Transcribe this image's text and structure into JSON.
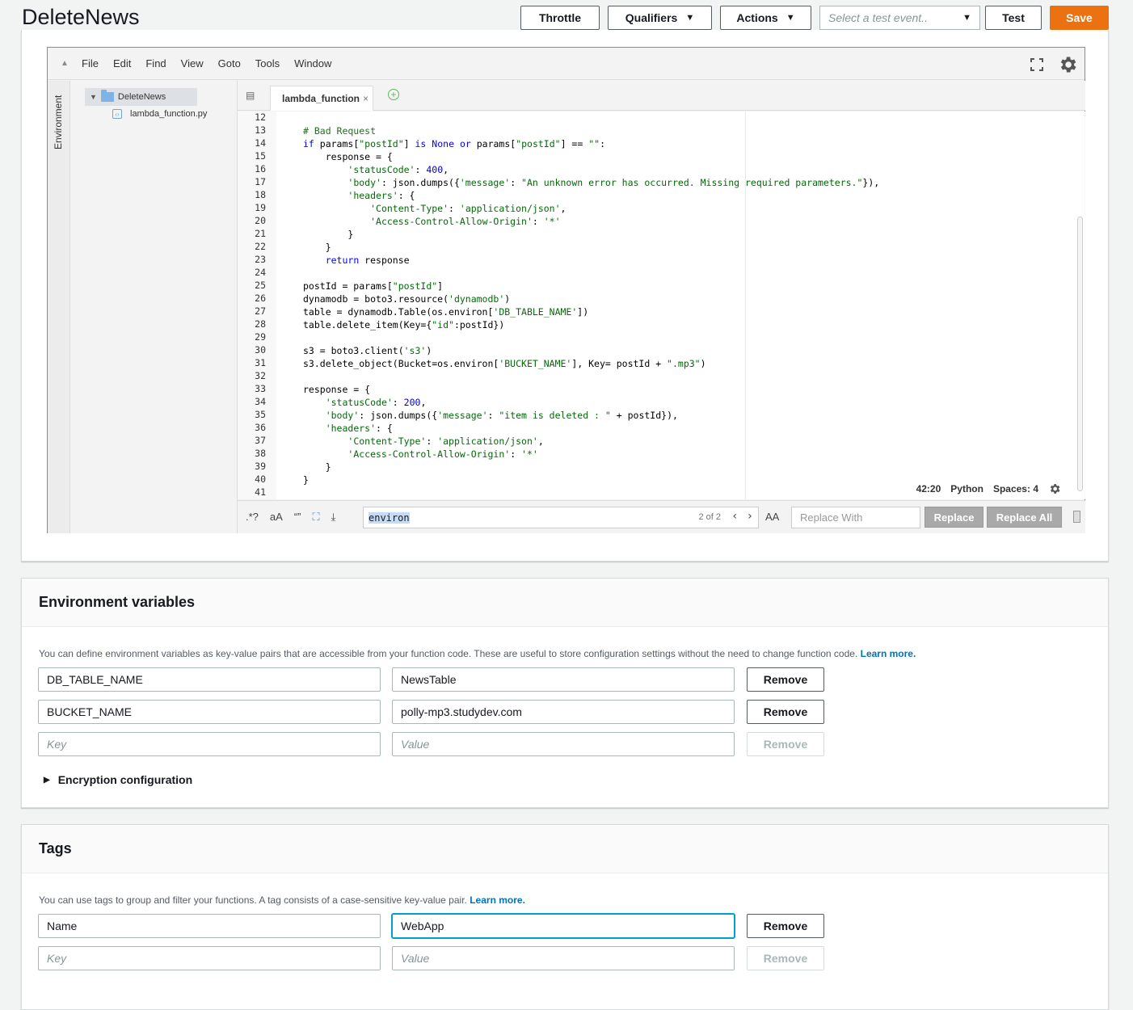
{
  "header": {
    "title": "DeleteNews",
    "throttle": "Throttle",
    "qualifiers": "Qualifiers",
    "actions": "Actions",
    "test_event_placeholder": "Select a test event..",
    "test": "Test",
    "save": "Save"
  },
  "ide": {
    "menu": [
      "File",
      "Edit",
      "Find",
      "View",
      "Goto",
      "Tools",
      "Window"
    ],
    "side_tab": "Environment",
    "tree": {
      "root": "DeleteNews",
      "file": "lambda_function.py"
    },
    "tab": "lambda_function",
    "line_numbers": [
      "12",
      "13",
      "14",
      "15",
      "16",
      "17",
      "18",
      "19",
      "20",
      "21",
      "22",
      "23",
      "24",
      "25",
      "26",
      "27",
      "28",
      "29",
      "30",
      "31",
      "32",
      "33",
      "34",
      "35",
      "36",
      "37",
      "38",
      "39",
      "40",
      "41"
    ],
    "status": {
      "cursor": "42:20",
      "language": "Python",
      "spaces": "Spaces: 4"
    },
    "find": {
      "query": "environ",
      "count": "2 of 2",
      "replace_placeholder": "Replace With",
      "replace": "Replace",
      "replace_all": "Replace All",
      "opt_regex": ".*?",
      "opt_case": "aA",
      "opt_word": "“”",
      "opt_selection": "⛶",
      "opt_aa": "AA"
    }
  },
  "env": {
    "title": "Environment variables",
    "description": "You can define environment variables as key-value pairs that are accessible from your function code. These are useful to store configuration settings without the need to change function code.",
    "learn_more": "Learn more.",
    "rows": [
      {
        "key": "DB_TABLE_NAME",
        "value": "NewsTable"
      },
      {
        "key": "BUCKET_NAME",
        "value": "polly-mp3.studydev.com"
      }
    ],
    "key_placeholder": "Key",
    "value_placeholder": "Value",
    "remove": "Remove",
    "encryption": "Encryption configuration"
  },
  "tags": {
    "title": "Tags",
    "description": "You can use tags to group and filter your functions. A tag consists of a case-sensitive key-value pair.",
    "learn_more": "Learn more.",
    "rows": [
      {
        "key": "Name",
        "value": "WebApp"
      }
    ],
    "key_placeholder": "Key",
    "value_placeholder": "Value",
    "remove": "Remove"
  },
  "colors": {
    "primary": "#ec7211",
    "link": "#0073bb",
    "focus": "#00a1c9"
  },
  "code_lines": [
    "",
    "# Bad Request",
    "if params[\"postId\"] is None or params[\"postId\"] == \"\":",
    "    response = {",
    "        'statusCode': 400,",
    "        'body': json.dumps({'message': \"An unknown error has occurred. Missing required parameters.\"}),",
    "        'headers': {",
    "            'Content-Type': 'application/json',",
    "            'Access-Control-Allow-Origin': '*'",
    "        }",
    "    }",
    "    return response",
    "",
    "postId = params[\"postId\"]",
    "dynamodb = boto3.resource('dynamodb')",
    "table = dynamodb.Table(os.environ['DB_TABLE_NAME'])",
    "table.delete_item(Key={\"id\":postId})",
    "",
    "s3 = boto3.client('s3')",
    "s3.delete_object(Bucket=os.environ['BUCKET_NAME'], Key= postId + \".mp3\")",
    "",
    "response = {",
    "    'statusCode': 200,",
    "    'body': json.dumps({'message': \"item is deleted : \" + postId}),",
    "    'headers': {",
    "        'Content-Type': 'application/json',",
    "        'Access-Control-Allow-Origin': '*'",
    "    }",
    "}",
    ""
  ]
}
